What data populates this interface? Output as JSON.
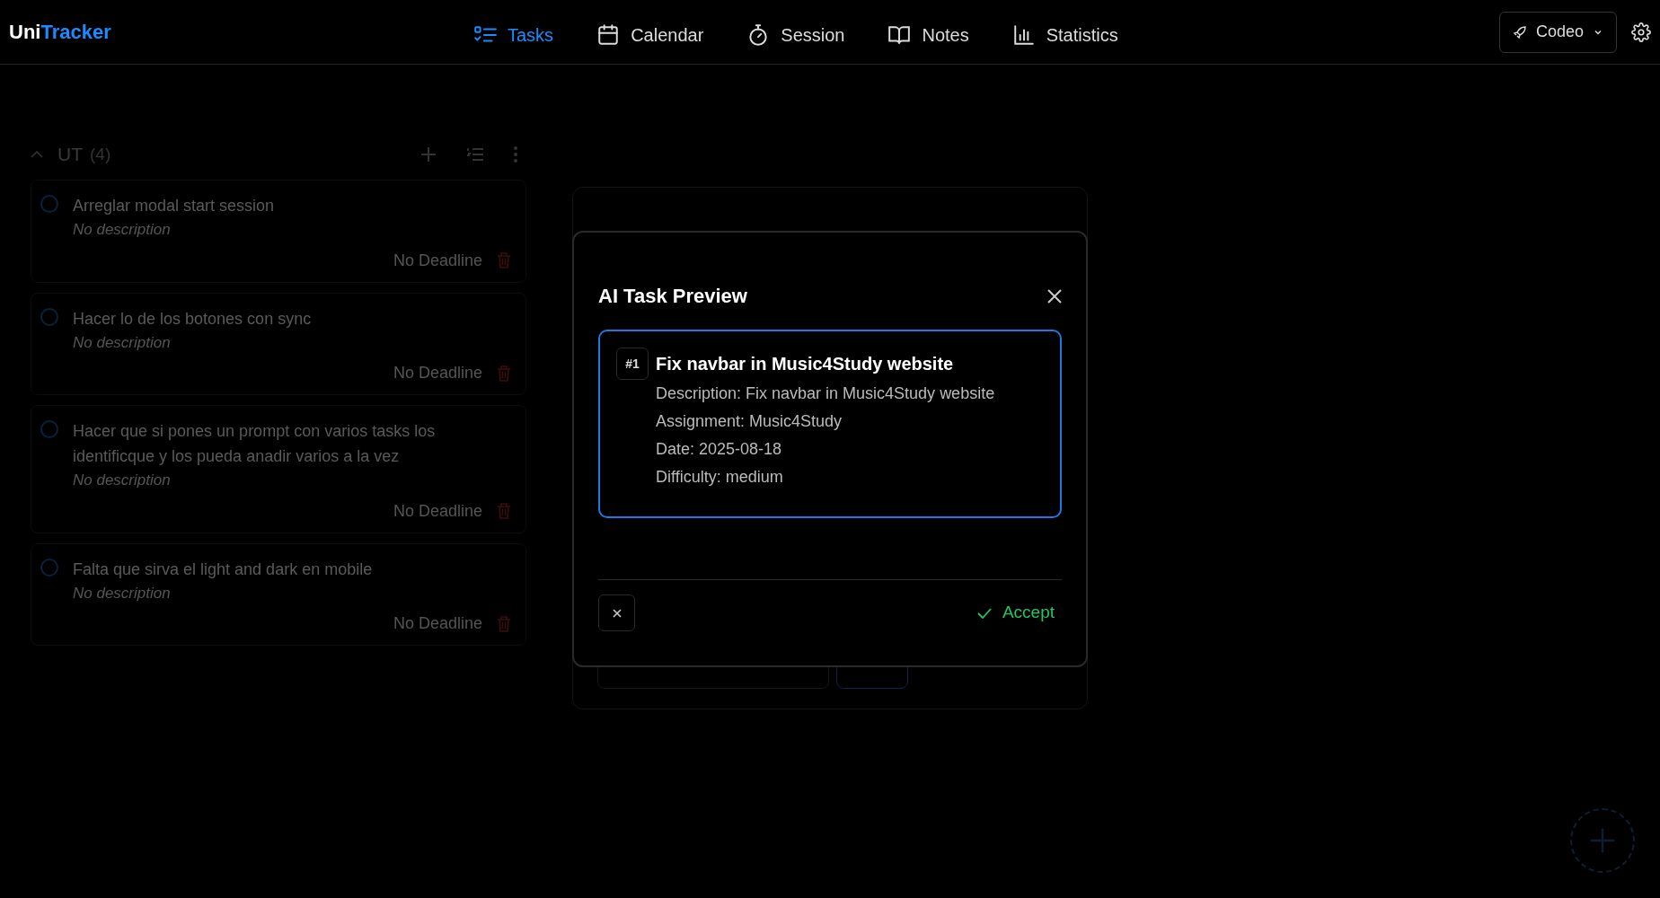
{
  "brand": {
    "first": "Uni",
    "second": "Tracker"
  },
  "nav": [
    {
      "label": "Tasks",
      "selected": true
    },
    {
      "label": "Calendar",
      "selected": false
    },
    {
      "label": "Session",
      "selected": false
    },
    {
      "label": "Notes",
      "selected": false
    },
    {
      "label": "Statistics",
      "selected": false
    }
  ],
  "workspace_menu": {
    "label": "Codeo"
  },
  "task_group": {
    "name": "UT",
    "count": "(4)",
    "expanded": true,
    "tasks": [
      {
        "title": "Arreglar modal start session",
        "description": "No description",
        "deadline": "No Deadline",
        "done": false
      },
      {
        "title": "Hacer lo de los botones con sync",
        "description": "No description",
        "deadline": "No Deadline",
        "done": false
      },
      {
        "title": "Hacer que si pones un prompt con varios tasks los identificque y los pueda anadir varios a la vez",
        "description": "No description",
        "deadline": "No Deadline",
        "done": false
      },
      {
        "title": "Falta que sirva el light and dark en mobile",
        "description": "No description",
        "deadline": "No Deadline",
        "done": false
      }
    ]
  },
  "modal": {
    "title": "AI Task Preview",
    "tasks": [
      {
        "number": "#1",
        "title": "Fix navbar in Music4Study website",
        "details": [
          "Description: Fix navbar in Music4Study website",
          "Assignment: Music4Study",
          "Date: 2025-08-18",
          "Difficulty: medium"
        ]
      }
    ],
    "accept": "Accept"
  }
}
